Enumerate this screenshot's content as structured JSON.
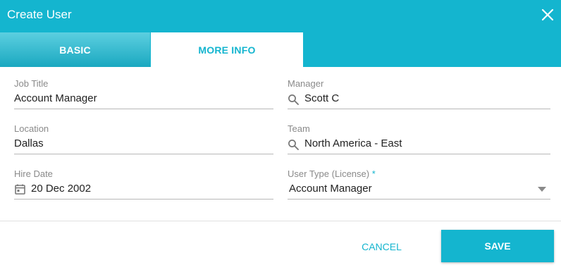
{
  "dialog": {
    "title": "Create User"
  },
  "tabs": [
    {
      "label": "BASIC",
      "active": false
    },
    {
      "label": "MORE INFO",
      "active": true
    }
  ],
  "form": {
    "job_title": {
      "label": "Job Title",
      "value": "Account Manager"
    },
    "manager": {
      "label": "Manager",
      "value": "Scott C",
      "icon": "search-icon"
    },
    "location": {
      "label": "Location",
      "value": "Dallas"
    },
    "team": {
      "label": "Team",
      "value": "North America - East",
      "icon": "search-icon"
    },
    "hire_date": {
      "label": "Hire Date",
      "value": "20 Dec 2002",
      "icon": "calendar-icon"
    },
    "user_type": {
      "label": "User Type (License)",
      "required_marker": "*",
      "value": "Account Manager",
      "icon": "dropdown-arrow-icon"
    }
  },
  "actions": {
    "cancel_label": "CANCEL",
    "save_label": "SAVE"
  },
  "colors": {
    "accent": "#14b5cf",
    "label": "#8a8a8a",
    "underline": "#b8b8b8"
  }
}
